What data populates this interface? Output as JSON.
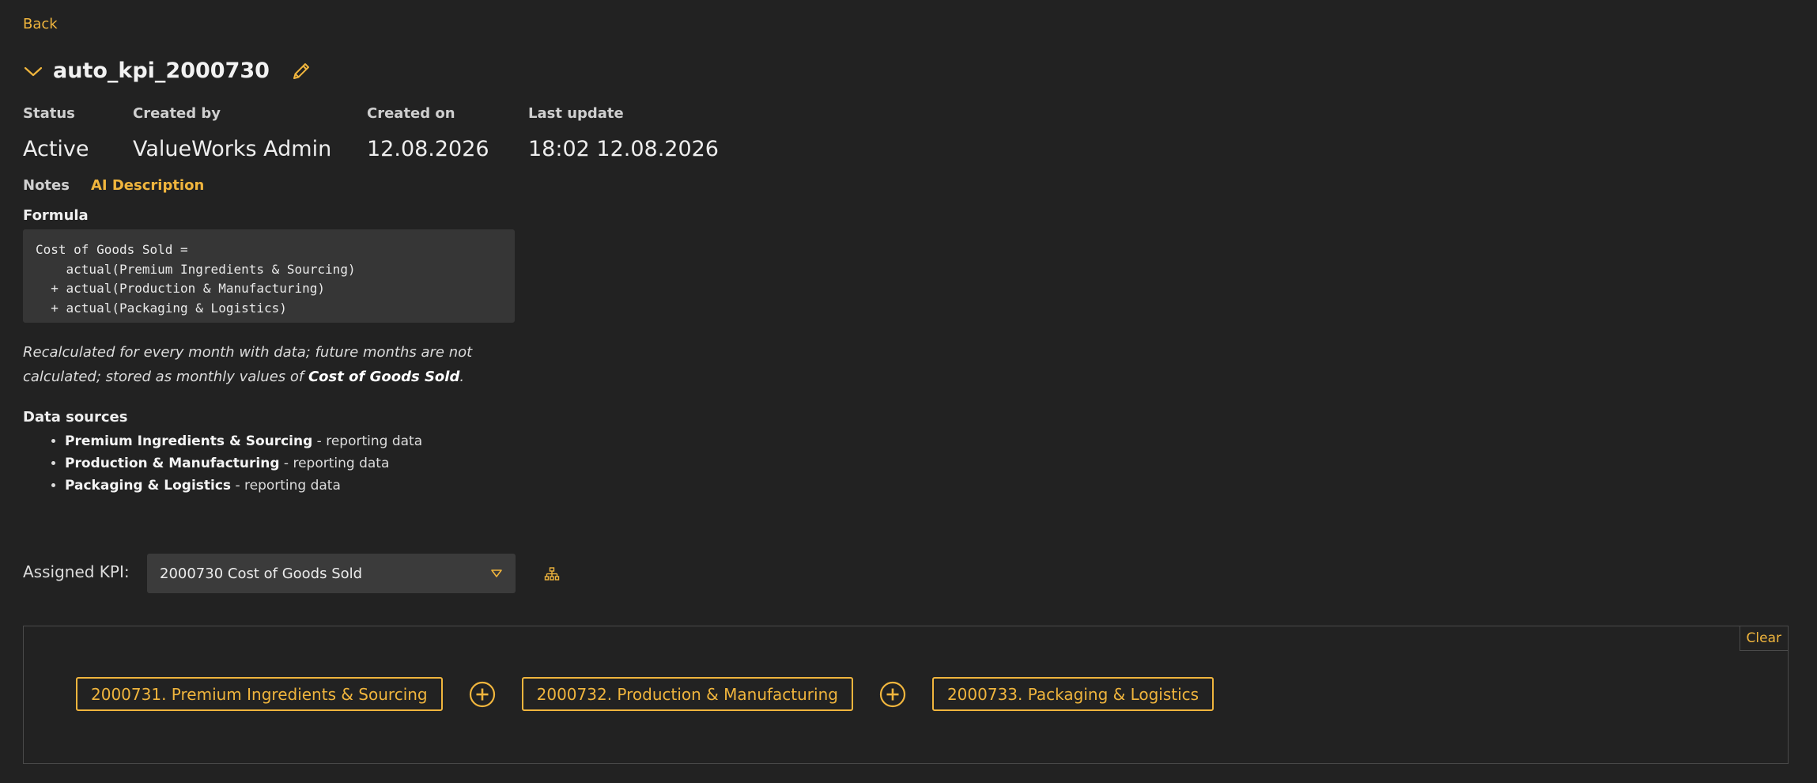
{
  "nav": {
    "back_label": "Back"
  },
  "header": {
    "title": "auto_kpi_2000730"
  },
  "meta": {
    "status": {
      "label": "Status",
      "value": "Active"
    },
    "created_by": {
      "label": "Created by",
      "value": "ValueWorks Admin"
    },
    "created_on": {
      "label": "Created on",
      "value": "12.08.2026"
    },
    "last_update": {
      "label": "Last update",
      "value": "18:02 12.08.2026"
    }
  },
  "tabs": {
    "notes": "Notes",
    "ai_description": "AI Description"
  },
  "formula": {
    "label": "Formula",
    "code": "Cost of Goods Sold =\n    actual(Premium Ingredients & Sourcing)\n  + actual(Production & Manufacturing)\n  + actual(Packaging & Logistics)"
  },
  "note": {
    "text_before": "Recalculated for every month with data; future months are not calculated; stored as monthly values of ",
    "emphasis": "Cost of Goods Sold",
    "text_after": "."
  },
  "data_sources": {
    "label": "Data sources",
    "items": [
      {
        "name": "Premium Ingredients & Sourcing",
        "type": " - reporting data"
      },
      {
        "name": "Production & Manufacturing",
        "type": " - reporting data"
      },
      {
        "name": "Packaging & Logistics",
        "type": " - reporting data"
      }
    ]
  },
  "assigned": {
    "label": "Assigned KPI:",
    "selected": "2000730 Cost of Goods Sold"
  },
  "builder": {
    "clear_label": "Clear",
    "chips": [
      "2000731. Premium Ingredients & Sourcing",
      "2000732. Production & Manufacturing",
      "2000733. Packaging & Logistics"
    ],
    "operator": "plus"
  },
  "colors": {
    "accent": "#f0b53d",
    "background": "#222222",
    "panel": "#363636"
  }
}
